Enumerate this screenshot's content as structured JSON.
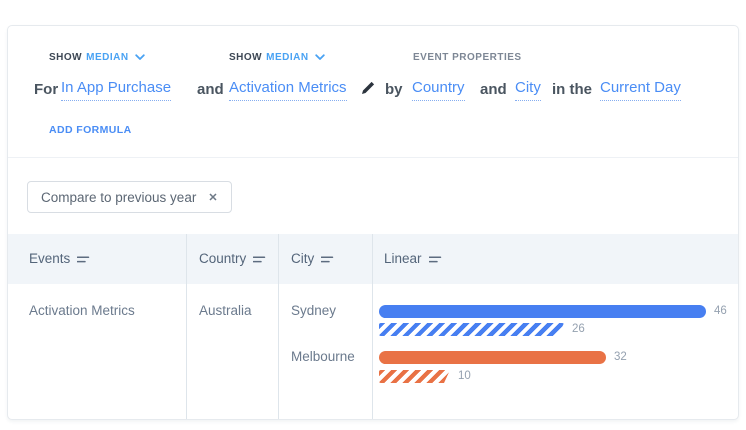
{
  "query_builder": {
    "show_1": {
      "label": "SHOW",
      "value": "MEDIAN"
    },
    "show_2": {
      "label": "SHOW",
      "value": "MEDIAN"
    },
    "event_properties_label": "EVENT PROPERTIES",
    "for_label": "For",
    "event_1": "In App Purchase",
    "and_1": "and",
    "event_2": "Activation Metrics",
    "by_label": "by",
    "property_1": "Country",
    "and_2": "and",
    "property_2": "City",
    "in_the_label": "in the",
    "date_range": "Current Day",
    "add_formula_label": "ADD FORMULA"
  },
  "segments": {
    "compare_chip_label": "Compare to previous year"
  },
  "icons": {
    "close": "✕"
  },
  "table": {
    "columns": [
      "Events",
      "Country",
      "City",
      "Linear"
    ],
    "row": {
      "event": "Activation Metrics",
      "country": "Australia",
      "groups": [
        {
          "city": "Sydney",
          "bars": [
            {
              "value": 46,
              "series": "current",
              "style": "solid",
              "color": "#477ff1"
            },
            {
              "value": 26,
              "series": "previous year",
              "style": "hatched",
              "color": "#477ff1"
            }
          ]
        },
        {
          "city": "Melbourne",
          "bars": [
            {
              "value": 32,
              "series": "current",
              "style": "solid",
              "color": "#e97245"
            },
            {
              "value": 10,
              "series": "previous year",
              "style": "hatched",
              "color": "#e97245"
            }
          ]
        }
      ]
    }
  },
  "chart_data": {
    "type": "bar",
    "orientation": "horizontal",
    "categories": [
      "Sydney",
      "Melbourne"
    ],
    "series": [
      {
        "name": "current",
        "style": "solid",
        "values": [
          46,
          32
        ]
      },
      {
        "name": "previous year",
        "style": "hatched",
        "values": [
          26,
          10
        ]
      }
    ],
    "category_colors": {
      "Sydney": "#477ff1",
      "Melbourne": "#e97245"
    },
    "xmax": 46,
    "value_labels": true,
    "legend": false
  },
  "colors": {
    "link_blue": "#4a8df5",
    "selector_blue": "#49a2f3",
    "bar_blue": "#477ff1",
    "bar_orange": "#e97245",
    "table_header_bg": "#f1f5f9"
  }
}
